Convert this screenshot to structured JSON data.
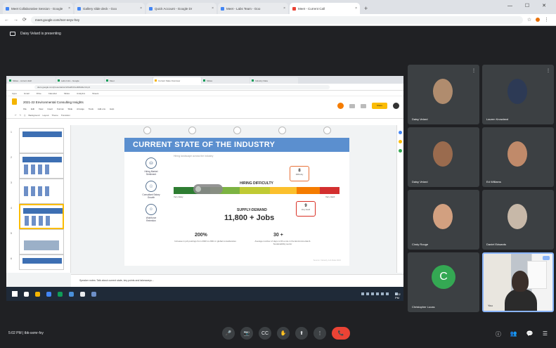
{
  "browser": {
    "tabs": [
      {
        "label": "Meet Collaborative Session - Google"
      },
      {
        "label": "Gallery slide deck - Goo"
      },
      {
        "label": "Quick Account - Google Dr"
      },
      {
        "label": "Meet - Labs Team - Goo"
      },
      {
        "label": "Meet - Current Call",
        "active": true
      }
    ],
    "address": "meet.google.com/mer-eeyv-hey",
    "new_tab": "+",
    "window_controls": "— ☐ ✕"
  },
  "meet": {
    "presenting_banner": "Daisy Velard is presenting",
    "time": "5:02 PM",
    "meeting_code": "tbk-sxmr-fxy",
    "controls": [
      "🎤",
      "📷",
      "CC",
      "✋",
      "⬆",
      "⋮",
      "📞"
    ],
    "right_controls": [
      "ⓘ",
      "👥",
      "💬",
      "☰"
    ],
    "participants": [
      {
        "name": "Daisy Velard",
        "photo_color": "#b08c6e"
      },
      {
        "name": "Lauren Knowland",
        "photo_color": "#2d3a55"
      },
      {
        "name": "Daisy Velard",
        "photo_color": "#9a6b4e"
      },
      {
        "name": "Ed Williams",
        "photo_color": "#c08a6a"
      },
      {
        "name": "Cindy Rouge",
        "photo_color": "#d2a080"
      },
      {
        "name": "Daniel Edwards",
        "photo_color": "#c7b8a8"
      },
      {
        "name": "Christopher Lucas",
        "avatar_letter": "C",
        "avatar_color": "#34a853"
      },
      {
        "name": "You",
        "self": true
      }
    ]
  },
  "shared_screen": {
    "tabs": [
      "Slides - current draft",
      "Labs Intro - Google",
      "Meet",
      "Current State Overview",
      "Slides",
      "Industry Data"
    ],
    "address": "docs.google.com/presentation/d/1a2b3c/edit#slide=id.p4",
    "bookmarks": [
      "Apps",
      "Gmail",
      "Drive",
      "Calendar",
      "Slides",
      "Analytics",
      "Sheets"
    ],
    "doc_title": "2021-22 Environmental Consulting Insights",
    "menus": [
      "File",
      "Edit",
      "View",
      "Insert",
      "Format",
      "Slide",
      "Arrange",
      "Tools",
      "Add-ons",
      "Help"
    ],
    "toolbar": [
      "Background",
      "Layout",
      "Theme",
      "Transition"
    ],
    "share_label": "Share",
    "slide_numbers": [
      "1",
      "2",
      "3",
      "4",
      "5",
      "6"
    ],
    "slide": {
      "title": "CURRENT STATE OF THE INDUSTRY",
      "subtitle": "Hiring landscape across the industry",
      "left_items": [
        {
          "icon": "⛁",
          "label": "Hiring Market\nSentiment"
        },
        {
          "icon": "☉",
          "label": "Consultant Salary\nGrowth"
        },
        {
          "icon": "☺",
          "label": "Workforce\nRetention"
        }
      ],
      "gauge_label": "HIRING DIFFICULTY",
      "gauge_low": "Very Easy",
      "gauge_high": "Very Hard",
      "callout_top": {
        "value": "8",
        "label": "Difficulty"
      },
      "callout_bottom": {
        "value": "9",
        "label": "Very Hard"
      },
      "supply_demand_label": "SUPPLY-DEMAND",
      "supply_demand_value": "11,800 + Jobs",
      "stat_left": {
        "value": "200%",
        "desc": "Increase in job postings from 2020 to 2021 in global consultancies"
      },
      "stat_right": {
        "value": "30 +",
        "desc": "Average number of days to fill a role in the Environmental & Sustainability sector"
      },
      "source": "Source: Industry Job Data 2021"
    },
    "speaker_notes": "Speaker notes: Talk about current state, key points and takeaways...",
    "yellow_note": "Finish slides 7 through 12"
  },
  "taskbar": {
    "clock": "5:02 PM"
  }
}
